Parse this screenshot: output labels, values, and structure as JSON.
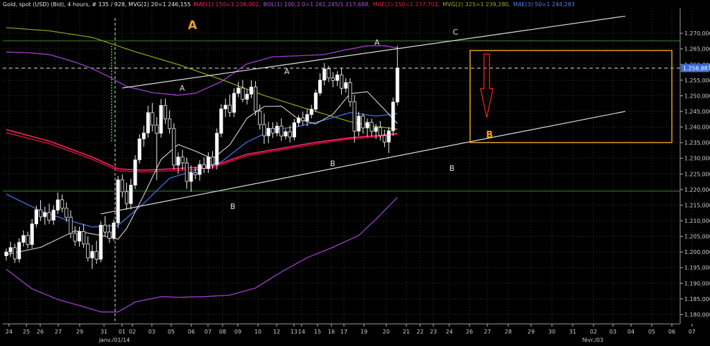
{
  "header": {
    "instrument": "Gold, spot (USD) (Bid), 4 hours, # 135 / 928, MVG(1) 20=1 246,155",
    "mae1": "MAE(1) 150=1 238,002,",
    "bol1": "BOL(1) 100;2.0=1 261,245/1 217,688,",
    "mae2": "MAE(2) 150=1 237,701,",
    "mvg2": "MVG(2) 325=1 239,280,",
    "mae3": "MAE(3) 50=1 244,283"
  },
  "colors": {
    "background": "#000000",
    "grid": "#3a3a3a",
    "candle_up": "#ffffff",
    "candle_down": "#ffffff",
    "mvg1": "#c8c8c8",
    "bollinger": "#a040d0",
    "mae1": "#ff1e6e",
    "mae2": "#c01030",
    "mvg2": "#8aa010",
    "mae3": "#3d6ad6",
    "trendline": "#e0e0e0",
    "horizontal_line": "#2e8b2e",
    "target_box": "#e0a020",
    "arrow": "#e02020",
    "big_label": "#f0a020",
    "last_price_bg": "#3d6ad6"
  },
  "chart_data": {
    "type": "candlestick",
    "ylim": [
      1177,
      1278
    ],
    "y_ticks": [
      1180,
      1185,
      1190,
      1195,
      1200,
      1205,
      1210,
      1215,
      1220,
      1225,
      1230,
      1235,
      1240,
      1245,
      1250,
      1255,
      1260,
      1265,
      1270
    ],
    "y_tick_labels": [
      "1.180,000",
      "1.185,000",
      "1.190,000",
      "1.195,000",
      "1.200,000",
      "1.205,000",
      "1.210,000",
      "1.215,000",
      "1.220,000",
      "1.225,000",
      "1.230,000",
      "1.235,000",
      "1.240,000",
      "1.245,000",
      "1.250,000",
      "1.255,000",
      "1.260,000",
      "1.265,000",
      "1.270,000"
    ],
    "x_ticks": [
      "24",
      "25",
      "26",
      "27",
      "29",
      "31",
      "01",
      "02",
      "03",
      "05",
      "06",
      "07",
      "08",
      "09",
      "10",
      "12",
      "13",
      "14",
      "15",
      "16",
      "17",
      "19",
      "20",
      "21",
      "22",
      "23",
      "24",
      "26",
      "27",
      "28",
      "29",
      "30",
      "31",
      "02",
      "03",
      "04",
      "05",
      "06",
      "07"
    ],
    "x_sublabels": [
      "janv./01/14",
      "févr./03"
    ],
    "last_price": 1258.881,
    "last_price_label": "1.258,881",
    "horizontal_levels": [
      1267.6,
      1219.5
    ],
    "dashed_level": 1258.881,
    "annotations": [
      "A",
      "A",
      "A",
      "A",
      "C",
      "B",
      "B",
      "B",
      "B",
      "B"
    ],
    "candles": [
      [
        1198.8,
        1201.1,
        1197.3,
        1200.0
      ],
      [
        1200.0,
        1203.3,
        1198.5,
        1201.4
      ],
      [
        1201.4,
        1202.6,
        1196.5,
        1197.8
      ],
      [
        1197.8,
        1204.4,
        1196.6,
        1203.1
      ],
      [
        1203.1,
        1206.9,
        1201.8,
        1205.3
      ],
      [
        1205.3,
        1206.5,
        1201.2,
        1202.4
      ],
      [
        1202.4,
        1210.6,
        1201.2,
        1209.0
      ],
      [
        1209.0,
        1214.8,
        1207.9,
        1213.5
      ],
      [
        1213.5,
        1216.6,
        1209.9,
        1211.3
      ],
      [
        1211.3,
        1214.5,
        1208.7,
        1212.6
      ],
      [
        1212.6,
        1215.5,
        1209.0,
        1210.2
      ],
      [
        1210.2,
        1214.9,
        1208.7,
        1213.4
      ],
      [
        1213.4,
        1219.0,
        1212.2,
        1216.7
      ],
      [
        1216.7,
        1218.4,
        1212.7,
        1214.0
      ],
      [
        1214.0,
        1215.9,
        1209.6,
        1211.1
      ],
      [
        1211.1,
        1213.3,
        1204.4,
        1206.0
      ],
      [
        1206.0,
        1208.2,
        1201.9,
        1203.5
      ],
      [
        1203.5,
        1208.1,
        1201.7,
        1206.6
      ],
      [
        1206.6,
        1209.0,
        1201.3,
        1202.6
      ],
      [
        1202.6,
        1205.0,
        1197.0,
        1198.1
      ],
      [
        1198.1,
        1202.2,
        1194.6,
        1200.2
      ],
      [
        1200.2,
        1203.6,
        1196.2,
        1197.7
      ],
      [
        1197.7,
        1209.8,
        1196.7,
        1208.6
      ],
      [
        1208.6,
        1211.5,
        1204.9,
        1206.4
      ],
      [
        1206.4,
        1208.9,
        1202.9,
        1204.4
      ],
      [
        1204.4,
        1210.3,
        1203.6,
        1209.3
      ],
      [
        1209.3,
        1224.4,
        1207.6,
        1223.1
      ],
      [
        1223.1,
        1224.8,
        1217.5,
        1219.3
      ],
      [
        1219.3,
        1222.2,
        1213.5,
        1215.5
      ],
      [
        1215.5,
        1223.4,
        1213.6,
        1221.4
      ],
      [
        1221.4,
        1231.0,
        1220.1,
        1229.5
      ],
      [
        1229.5,
        1237.7,
        1228.3,
        1236.2
      ],
      [
        1236.2,
        1240.4,
        1233.7,
        1238.1
      ],
      [
        1238.1,
        1246.8,
        1236.6,
        1244.6
      ],
      [
        1244.6,
        1247.7,
        1238.6,
        1240.6
      ],
      [
        1240.6,
        1243.2,
        1223.0,
        1238.0
      ],
      [
        1238.0,
        1249.0,
        1236.6,
        1246.9
      ],
      [
        1246.9,
        1249.1,
        1241.0,
        1242.6
      ],
      [
        1242.6,
        1245.4,
        1237.9,
        1239.5
      ],
      [
        1239.5,
        1241.2,
        1226.4,
        1227.8
      ],
      [
        1227.8,
        1231.9,
        1225.0,
        1230.4
      ],
      [
        1230.4,
        1232.7,
        1226.3,
        1228.5
      ],
      [
        1228.5,
        1230.2,
        1220.2,
        1222.6
      ],
      [
        1222.6,
        1227.7,
        1219.3,
        1225.4
      ],
      [
        1225.4,
        1227.3,
        1223.3,
        1224.8
      ],
      [
        1224.8,
        1229.4,
        1222.8,
        1228.0
      ],
      [
        1228.0,
        1230.3,
        1225.3,
        1226.7
      ],
      [
        1226.7,
        1231.9,
        1225.3,
        1230.4
      ],
      [
        1230.4,
        1232.3,
        1226.6,
        1228.0
      ],
      [
        1228.0,
        1239.6,
        1226.4,
        1238.0
      ],
      [
        1238.0,
        1247.3,
        1236.8,
        1245.8
      ],
      [
        1245.8,
        1249.1,
        1243.2,
        1247.0
      ],
      [
        1247.0,
        1250.4,
        1243.2,
        1244.7
      ],
      [
        1244.7,
        1252.4,
        1243.2,
        1250.8
      ],
      [
        1250.8,
        1254.5,
        1249.6,
        1252.5
      ],
      [
        1252.5,
        1255.1,
        1247.9,
        1248.9
      ],
      [
        1248.9,
        1252.1,
        1247.2,
        1250.5
      ],
      [
        1250.5,
        1255.0,
        1249.2,
        1252.8
      ],
      [
        1252.8,
        1254.7,
        1243.6,
        1245.1
      ],
      [
        1245.1,
        1247.2,
        1239.2,
        1240.8
      ],
      [
        1240.8,
        1244.3,
        1234.6,
        1237.2
      ],
      [
        1237.2,
        1241.6,
        1234.8,
        1239.6
      ],
      [
        1239.6,
        1241.5,
        1236.5,
        1238.1
      ],
      [
        1238.1,
        1241.6,
        1237.0,
        1240.3
      ],
      [
        1240.3,
        1242.8,
        1235.5,
        1237.1
      ],
      [
        1237.1,
        1239.4,
        1236.0,
        1238.5
      ],
      [
        1238.5,
        1240.5,
        1235.1,
        1236.8
      ],
      [
        1236.8,
        1242.6,
        1235.7,
        1241.4
      ],
      [
        1241.4,
        1243.8,
        1240.2,
        1242.9
      ],
      [
        1242.9,
        1244.9,
        1240.5,
        1242.0
      ],
      [
        1242.0,
        1245.7,
        1240.3,
        1244.0
      ],
      [
        1244.0,
        1247.1,
        1242.8,
        1245.7
      ],
      [
        1245.7,
        1252.0,
        1244.9,
        1250.9
      ],
      [
        1250.9,
        1257.2,
        1250.1,
        1255.0
      ],
      [
        1255.0,
        1260.5,
        1253.3,
        1258.6
      ],
      [
        1258.6,
        1259.6,
        1254.4,
        1255.7
      ],
      [
        1255.7,
        1257.6,
        1252.7,
        1254.9
      ],
      [
        1254.9,
        1257.9,
        1253.1,
        1256.7
      ],
      [
        1256.7,
        1258.9,
        1250.4,
        1252.4
      ],
      [
        1252.4,
        1255.7,
        1251.0,
        1254.2
      ],
      [
        1254.2,
        1255.6,
        1246.5,
        1248.1
      ],
      [
        1248.1,
        1250.3,
        1235.0,
        1238.7
      ],
      [
        1238.7,
        1244.9,
        1237.1,
        1243.5
      ],
      [
        1243.5,
        1244.4,
        1237.9,
        1239.7
      ],
      [
        1239.7,
        1242.7,
        1236.9,
        1241.5
      ],
      [
        1241.5,
        1242.7,
        1237.0,
        1238.6
      ],
      [
        1238.6,
        1241.0,
        1236.2,
        1239.9
      ],
      [
        1239.9,
        1241.9,
        1235.7,
        1237.3
      ],
      [
        1237.3,
        1239.2,
        1233.6,
        1235.2
      ],
      [
        1235.2,
        1240.0,
        1231.7,
        1238.8
      ],
      [
        1238.8,
        1249.4,
        1237.2,
        1248.0
      ],
      [
        1248.0,
        1266.0,
        1246.9,
        1258.9
      ]
    ],
    "mvg1_values": [
      [
        0,
        1199.2
      ],
      [
        8,
        1201.5
      ],
      [
        16,
        1206.8
      ],
      [
        22,
        1205.3
      ],
      [
        26,
        1204.1
      ],
      [
        28,
        1207.5
      ],
      [
        32,
        1218.2
      ],
      [
        36,
        1229.6
      ],
      [
        40,
        1234.4
      ],
      [
        44,
        1232.3
      ],
      [
        48,
        1229.8
      ],
      [
        52,
        1234.3
      ],
      [
        56,
        1242.8
      ],
      [
        60,
        1246.6
      ],
      [
        64,
        1246.7
      ],
      [
        68,
        1242.5
      ],
      [
        72,
        1241.0
      ],
      [
        76,
        1244.1
      ],
      [
        80,
        1250.7
      ],
      [
        84,
        1251.3
      ],
      [
        88,
        1245.6
      ],
      [
        91,
        1241.1
      ]
    ],
    "mae3_values": [
      [
        0,
        1218.5
      ],
      [
        8,
        1213.2
      ],
      [
        14,
        1210.3
      ],
      [
        20,
        1208.0
      ],
      [
        26,
        1208.5
      ],
      [
        32,
        1215.6
      ],
      [
        38,
        1223.6
      ],
      [
        44,
        1226.2
      ],
      [
        50,
        1228.8
      ],
      [
        56,
        1235.2
      ],
      [
        62,
        1239.1
      ],
      [
        68,
        1240.2
      ],
      [
        74,
        1242.2
      ],
      [
        80,
        1244.6
      ],
      [
        86,
        1243.5
      ],
      [
        91,
        1244.3
      ]
    ],
    "mae1_values": [
      [
        0,
        1239.2
      ],
      [
        10,
        1235.5
      ],
      [
        20,
        1230.4
      ],
      [
        26,
        1226.6
      ],
      [
        32,
        1226.2
      ],
      [
        40,
        1226.7
      ],
      [
        48,
        1227.5
      ],
      [
        56,
        1231.3
      ],
      [
        64,
        1233.2
      ],
      [
        72,
        1235.1
      ],
      [
        80,
        1236.6
      ],
      [
        86,
        1237.2
      ],
      [
        91,
        1238.0
      ]
    ],
    "mae2_values": [
      [
        0,
        1238.2
      ],
      [
        10,
        1234.7
      ],
      [
        20,
        1229.7
      ],
      [
        26,
        1226.0
      ],
      [
        32,
        1225.6
      ],
      [
        40,
        1226.1
      ],
      [
        48,
        1227.0
      ],
      [
        56,
        1230.8
      ],
      [
        64,
        1232.7
      ],
      [
        72,
        1234.6
      ],
      [
        80,
        1236.2
      ],
      [
        86,
        1236.8
      ],
      [
        91,
        1237.7
      ]
    ],
    "mvg2_values": [
      [
        0,
        1271.8
      ],
      [
        10,
        1270.8
      ],
      [
        20,
        1268.7
      ],
      [
        30,
        1264.1
      ],
      [
        40,
        1260.0
      ],
      [
        50,
        1255.2
      ],
      [
        60,
        1250.1
      ],
      [
        70,
        1245.8
      ],
      [
        80,
        1241.7
      ],
      [
        86,
        1240.2
      ],
      [
        91,
        1239.3
      ]
    ],
    "bol_upper_values": [
      [
        0,
        1264.0
      ],
      [
        5,
        1263.8
      ],
      [
        10,
        1263.2
      ],
      [
        16,
        1260.8
      ],
      [
        20,
        1258.7
      ],
      [
        24,
        1256.0
      ],
      [
        28,
        1253.0
      ],
      [
        34,
        1251.0
      ],
      [
        40,
        1250.2
      ],
      [
        44,
        1250.8
      ],
      [
        50,
        1254.5
      ],
      [
        56,
        1260.2
      ],
      [
        62,
        1262.5
      ],
      [
        68,
        1262.8
      ],
      [
        74,
        1263.2
      ],
      [
        79,
        1264.7
      ],
      [
        84,
        1266.0
      ],
      [
        88,
        1266.0
      ],
      [
        91,
        1265.3
      ]
    ],
    "bol_lower_values": [
      [
        0,
        1194.5
      ],
      [
        6,
        1188.2
      ],
      [
        12,
        1184.8
      ],
      [
        18,
        1182.5
      ],
      [
        22,
        1180.8
      ],
      [
        26,
        1180.8
      ],
      [
        30,
        1184.0
      ],
      [
        36,
        1185.7
      ],
      [
        40,
        1185.5
      ],
      [
        46,
        1185.7
      ],
      [
        52,
        1186.2
      ],
      [
        58,
        1188.5
      ],
      [
        64,
        1193.6
      ],
      [
        70,
        1198.2
      ],
      [
        76,
        1201.5
      ],
      [
        82,
        1205.3
      ],
      [
        86,
        1210.5
      ],
      [
        91,
        1217.5
      ]
    ],
    "trendlines": [
      {
        "x1": 27,
        "y1": 1252.5,
        "x2": 144,
        "y2": 1275.5
      },
      {
        "x1": 22,
        "y1": 1212.2,
        "x2": 144,
        "y2": 1245.0
      }
    ]
  },
  "labels": {
    "big_a": "A",
    "big_b": "B",
    "peak_a1": "A",
    "peak_a2": "A",
    "peak_a3": "A",
    "peak_c": "C",
    "trough_b1": "B",
    "trough_b2": "B",
    "trough_b3": "B"
  }
}
